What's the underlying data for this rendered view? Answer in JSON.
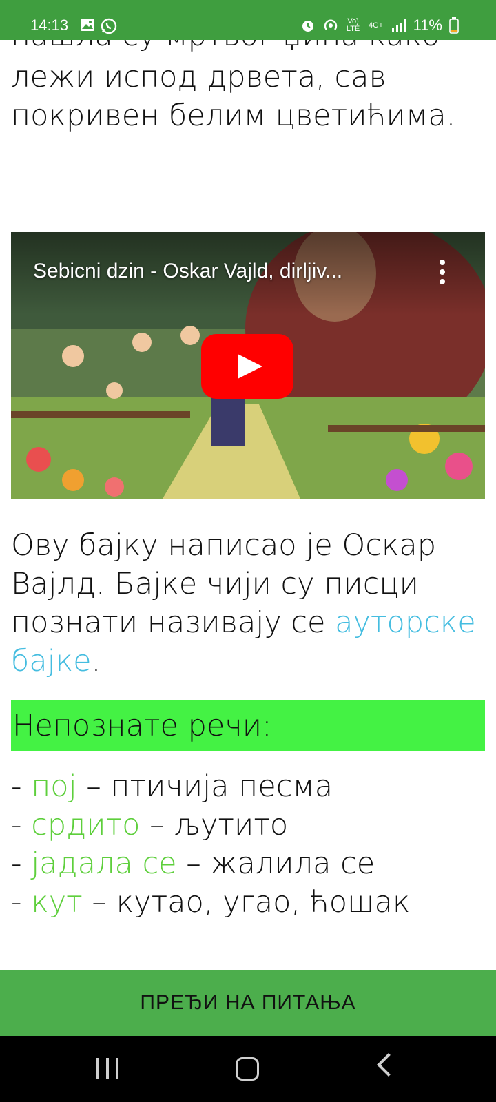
{
  "status_bar": {
    "time": "14:13",
    "battery": "11%",
    "volte": "Vo) LTE",
    "network": "4G+"
  },
  "story": {
    "cut_line": "нашла су мртвог џина како",
    "line1": "лежи испод дрвета, сав",
    "line2": "покривен белим цветићима."
  },
  "video": {
    "title": "Sebicni dzin - Oskar Vajld, dirljiv..."
  },
  "paragraph": {
    "text_before": "Ову бајку написао је Оскар Вајлд. Бајке чији су писци познати називају се ",
    "link_text": "ауторске бајке",
    "text_after": "."
  },
  "vocab": {
    "header": "Непознате речи:",
    "items": [
      {
        "prefix": "- ",
        "word": "пој",
        "meaning": " – птичија песма"
      },
      {
        "prefix": "- ",
        "word": "срдито",
        "meaning": " – љутито"
      },
      {
        "prefix": "- ",
        "word": "јадала се",
        "meaning": " – жалила се"
      },
      {
        "prefix": "- ",
        "word": "кут",
        "meaning": " – кутао, угао, ћошак"
      }
    ]
  },
  "bottom_button": {
    "label": "ПРЕЂИ НА ПИТАЊА"
  },
  "colors": {
    "status_bar": "#3f9e3f",
    "highlight_box": "#44f244",
    "vocab_word": "#5ecf3c",
    "link": "#45bde0",
    "bottom_button": "#4cae4c"
  }
}
